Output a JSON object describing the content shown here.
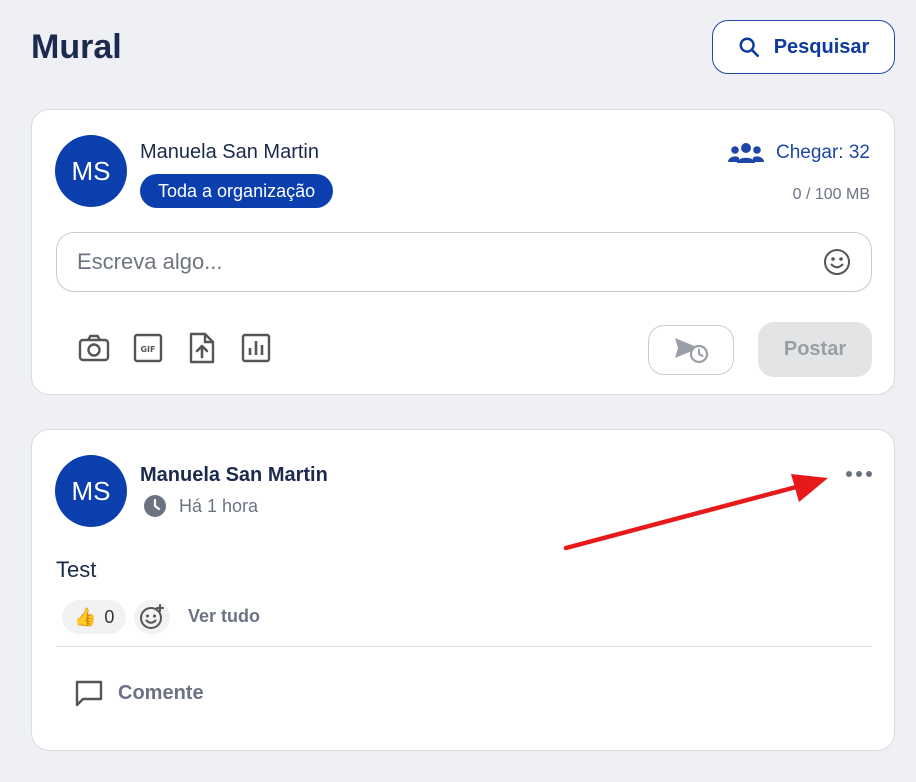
{
  "header": {
    "title": "Mural",
    "search_label": "Pesquisar"
  },
  "composer": {
    "avatar_initials": "MS",
    "author": "Manuela San Martin",
    "audience": "Toda a organização",
    "reach": "Chegar: 32",
    "storage": "0 / 100 MB",
    "placeholder": "Escreva algo...",
    "tools": [
      "camera-icon",
      "gif-icon",
      "upload-file-icon",
      "poll-chart-icon"
    ],
    "schedule_icon": "schedule-send-icon",
    "post_label": "Postar"
  },
  "post": {
    "avatar_initials": "MS",
    "author": "Manuela San Martin",
    "time": "Há 1 hora",
    "text": "Test",
    "reaction_emoji": "👍",
    "reaction_count": "0",
    "see_all": "Ver tudo",
    "comment_label": "Comente"
  },
  "colors": {
    "brand": "#0b3fae",
    "annotation_arrow": "#e8191a"
  }
}
